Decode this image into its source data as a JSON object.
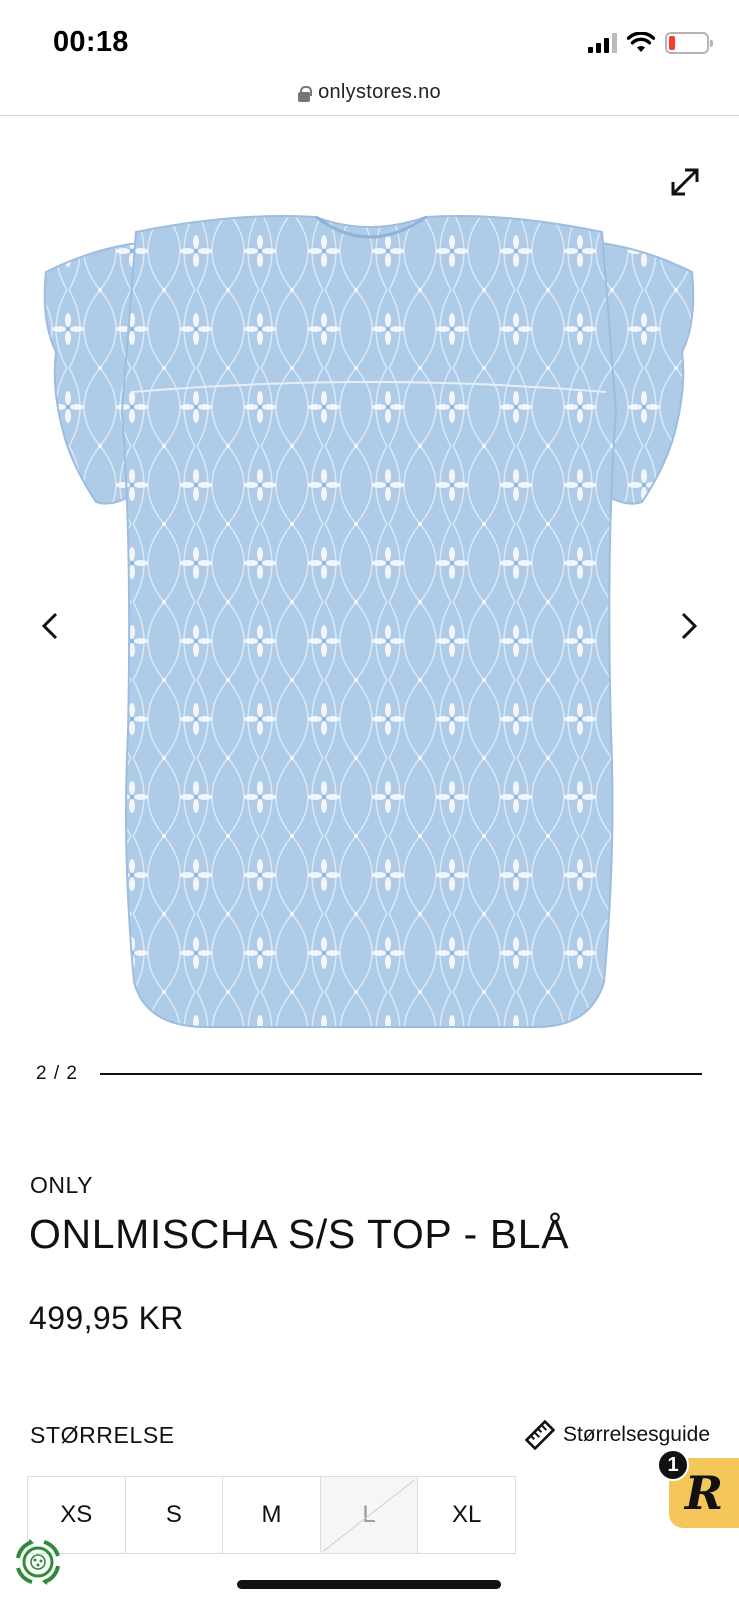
{
  "status_bar": {
    "time": "00:18",
    "battery_level_percent": 15,
    "battery_color": "#ff3b30"
  },
  "browser": {
    "url": "onlystores.no",
    "lock_icon": "lock-icon"
  },
  "gallery": {
    "pager": "2 / 2",
    "expand_icon": "expand-icon",
    "prev_icon": "chevron-left-icon",
    "next_icon": "chevron-right-icon",
    "image_color": "#aecbe7"
  },
  "product": {
    "brand": "ONLY",
    "title": "ONLMISCHA S/S TOP - BLÅ",
    "price": "499,95 KR"
  },
  "size_section": {
    "label": "STØRRELSE",
    "guide_label": "Størrelsesguide",
    "guide_icon": "ruler-icon",
    "options": [
      {
        "label": "XS",
        "available": true
      },
      {
        "label": "S",
        "available": true
      },
      {
        "label": "M",
        "available": true
      },
      {
        "label": "L",
        "available": false
      },
      {
        "label": "XL",
        "available": true
      }
    ]
  },
  "review_widget": {
    "letter": "R",
    "count": "1",
    "color": "#f5c75a"
  },
  "eco_badge": {
    "icon": "recycle-icon",
    "color": "#2e8b3a"
  }
}
